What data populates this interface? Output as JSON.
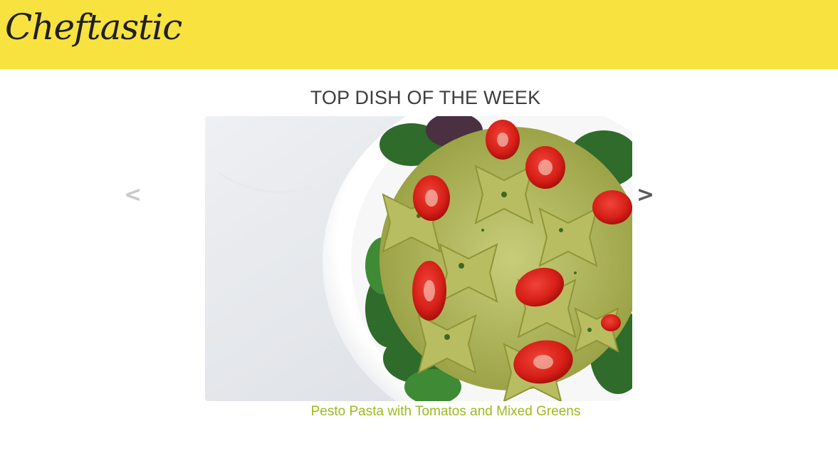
{
  "header": {
    "logo_text": "Cheftastic",
    "background_color": "#f7e23f"
  },
  "featured": {
    "title": "TOP DISH OF THE WEEK",
    "prev_label": "<",
    "next_label": ">",
    "image_icon": "pasta-dish-photo",
    "caption": "Pesto Pasta with Tomatos and Mixed Greens",
    "caption_color": "#9dba1c"
  }
}
